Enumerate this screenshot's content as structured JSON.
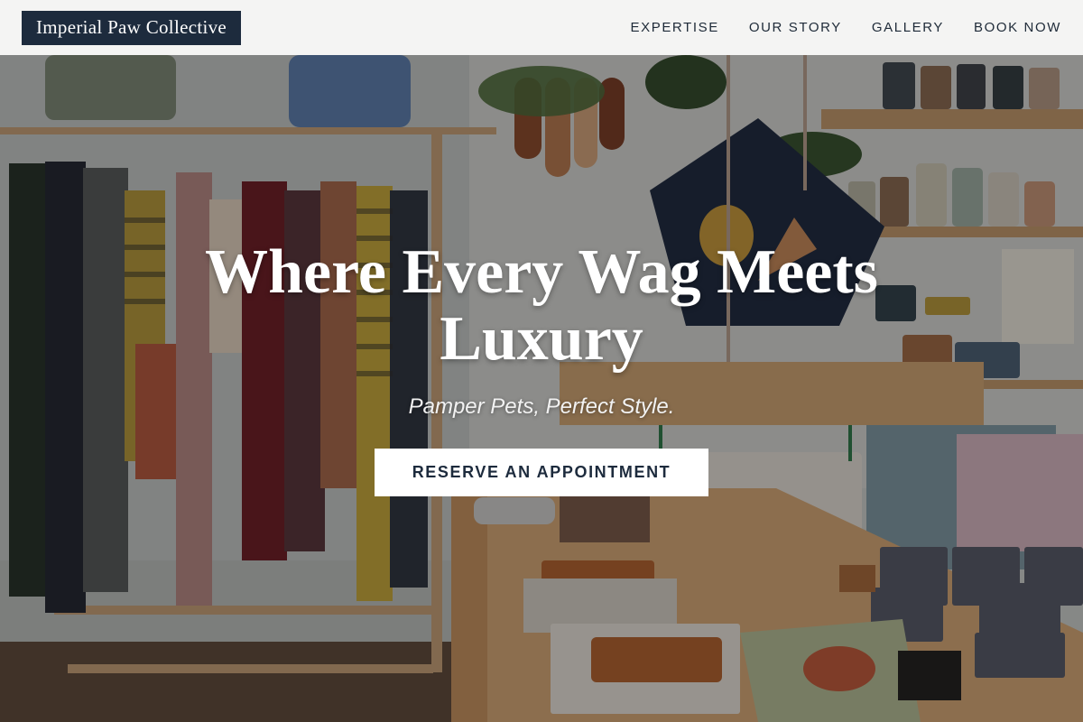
{
  "header": {
    "brand": "Imperial Paw Collective",
    "nav": [
      {
        "label": "EXPERTISE"
      },
      {
        "label": "OUR STORY"
      },
      {
        "label": "GALLERY"
      },
      {
        "label": "BOOK NOW"
      }
    ]
  },
  "hero": {
    "title": "Where Every Wag Meets Luxury",
    "subtitle": "Pamper Pets, Perfect Style.",
    "cta_label": "RESERVE AN APPOINTMENT"
  },
  "colors": {
    "brand_navy": "#1d2b3d",
    "header_bg": "#f4f4f3",
    "cta_bg": "#ffffff",
    "overlay": "rgba(15,12,10,0.38)"
  }
}
